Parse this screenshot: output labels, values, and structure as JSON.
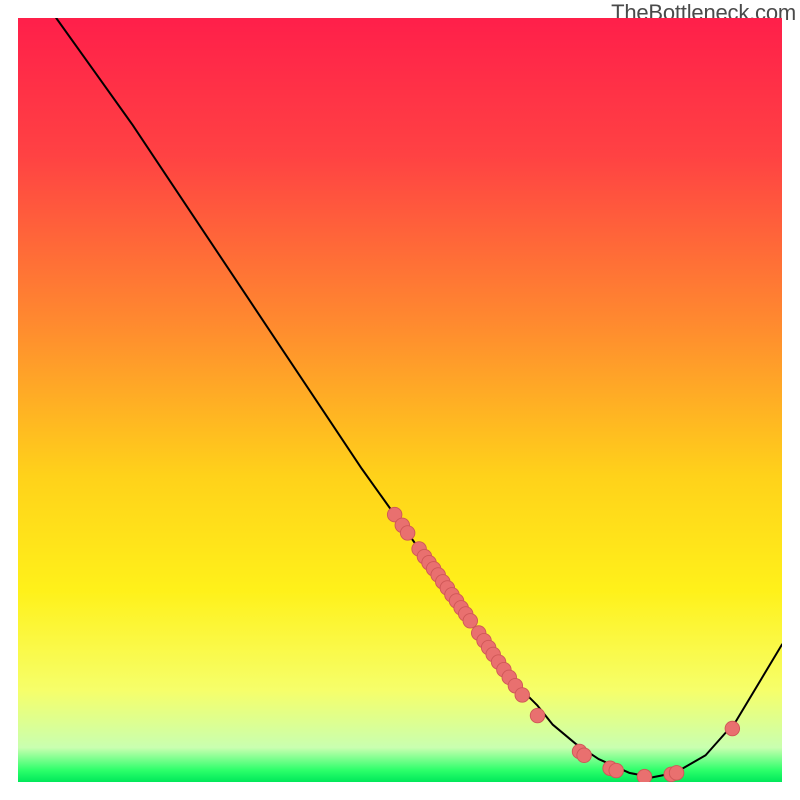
{
  "watermark": {
    "text": "TheBottleneck.com"
  },
  "colors": {
    "gradient_stops": [
      {
        "offset": 0.0,
        "color": "#ff1f4a"
      },
      {
        "offset": 0.18,
        "color": "#ff4243"
      },
      {
        "offset": 0.4,
        "color": "#ff8a2f"
      },
      {
        "offset": 0.6,
        "color": "#ffd21a"
      },
      {
        "offset": 0.75,
        "color": "#fff11a"
      },
      {
        "offset": 0.88,
        "color": "#f6ff6a"
      },
      {
        "offset": 0.955,
        "color": "#c9ffb0"
      },
      {
        "offset": 0.985,
        "color": "#2bff6a"
      },
      {
        "offset": 1.0,
        "color": "#00e85a"
      }
    ],
    "curve_stroke": "#000000",
    "marker_fill": "#e9706f",
    "marker_stroke": "#cf5757"
  },
  "chart_data": {
    "type": "line",
    "title": "",
    "xlabel": "",
    "ylabel": "",
    "xlim": [
      0,
      100
    ],
    "ylim": [
      0,
      100
    ],
    "grid": false,
    "legend": "none",
    "series": [
      {
        "name": "bottleneck_curve",
        "x": [
          5,
          10,
          15,
          20,
          25,
          30,
          35,
          40,
          45,
          50,
          55,
          58,
          60,
          63,
          65,
          68,
          70,
          73,
          76,
          80,
          83,
          86,
          90,
          94,
          100
        ],
        "y": [
          100,
          93,
          86,
          78.5,
          71,
          63.5,
          56,
          48.5,
          41,
          34,
          27,
          23,
          20,
          16,
          13,
          10,
          7.5,
          5,
          3,
          1.2,
          0.6,
          1.2,
          3.5,
          8,
          18
        ]
      }
    ],
    "markers": [
      {
        "x": 49.3,
        "y": 35.0
      },
      {
        "x": 50.3,
        "y": 33.6
      },
      {
        "x": 51.0,
        "y": 32.6
      },
      {
        "x": 52.5,
        "y": 30.5
      },
      {
        "x": 53.2,
        "y": 29.5
      },
      {
        "x": 53.8,
        "y": 28.7
      },
      {
        "x": 54.4,
        "y": 27.9
      },
      {
        "x": 55.0,
        "y": 27.1
      },
      {
        "x": 55.6,
        "y": 26.2
      },
      {
        "x": 56.2,
        "y": 25.4
      },
      {
        "x": 56.8,
        "y": 24.5
      },
      {
        "x": 57.4,
        "y": 23.7
      },
      {
        "x": 58.0,
        "y": 22.8
      },
      {
        "x": 58.6,
        "y": 22.0
      },
      {
        "x": 59.2,
        "y": 21.1
      },
      {
        "x": 60.3,
        "y": 19.5
      },
      {
        "x": 61.0,
        "y": 18.5
      },
      {
        "x": 61.6,
        "y": 17.6
      },
      {
        "x": 62.2,
        "y": 16.7
      },
      {
        "x": 62.9,
        "y": 15.7
      },
      {
        "x": 63.6,
        "y": 14.7
      },
      {
        "x": 64.3,
        "y": 13.7
      },
      {
        "x": 65.1,
        "y": 12.6
      },
      {
        "x": 66.0,
        "y": 11.4
      },
      {
        "x": 68.0,
        "y": 8.7
      },
      {
        "x": 73.5,
        "y": 4.0
      },
      {
        "x": 74.1,
        "y": 3.5
      },
      {
        "x": 77.5,
        "y": 1.8
      },
      {
        "x": 78.3,
        "y": 1.5
      },
      {
        "x": 82.0,
        "y": 0.7
      },
      {
        "x": 85.5,
        "y": 1.0
      },
      {
        "x": 86.2,
        "y": 1.2
      },
      {
        "x": 93.5,
        "y": 7.0
      }
    ]
  }
}
